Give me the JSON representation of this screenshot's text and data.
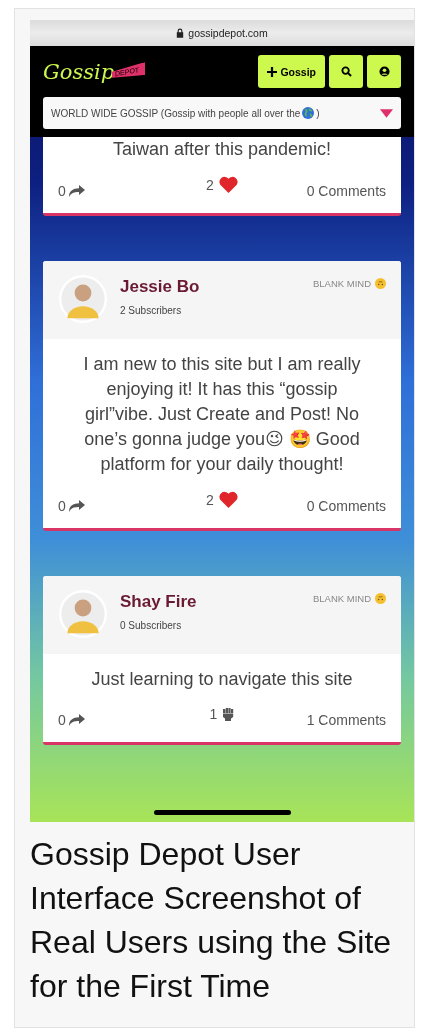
{
  "browser": {
    "url": "gossipdepot.com"
  },
  "header": {
    "logo": {
      "word": "Gossip",
      "tag": "DEPOT"
    },
    "buttons": [
      {
        "kind": "add",
        "label": "Gossip"
      },
      {
        "kind": "search"
      },
      {
        "kind": "account"
      }
    ]
  },
  "channel_select": {
    "value": "WORLD WIDE GOSSIP (Gossip with people all over the",
    "value_end": ")"
  },
  "posts": [
    {
      "body": "Taiwan after this pandemic!",
      "shares": "0",
      "reaction": {
        "kind": "heart",
        "count": "2"
      },
      "comments": "0 Comments"
    },
    {
      "author": "Jessie Bo",
      "subscribers": "2 Subscribers",
      "mood": "BLANK MIND",
      "body": "I am new to this site but I am really enjoying it! It has this “gossip girl”vibe. Just Create and Post! No one’s gonna judge you😉 🤩 Good platform for your daily thought!",
      "shares": "0",
      "reaction": {
        "kind": "heart",
        "count": "2"
      },
      "comments": "0 Comments"
    },
    {
      "author": "Shay Fire",
      "subscribers": "0 Subscribers",
      "mood": "BLANK MIND",
      "body": "Just learning to navigate this site",
      "shares": "0",
      "reaction": {
        "kind": "fist",
        "count": "1"
      },
      "comments": "1 Comments"
    }
  ],
  "caption": "Gossip Depot User Interface Screenshot of Real Users using the Site for the First Time"
}
